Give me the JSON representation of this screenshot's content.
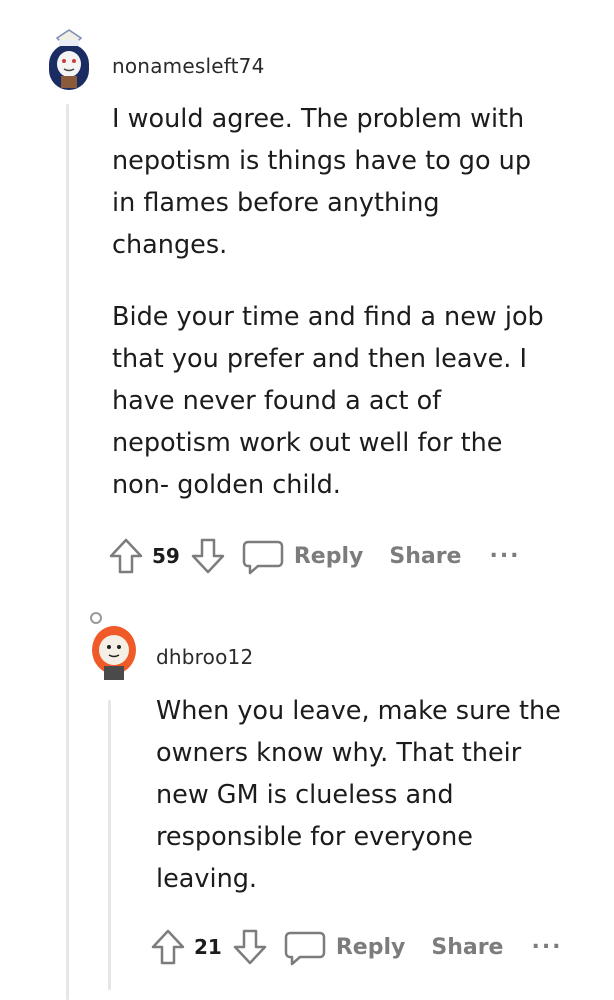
{
  "comments": [
    {
      "username": "nonamesleft74",
      "paragraphs": [
        "I would agree. The problem with nepotism is things have to go up in flames before anything changes.",
        "Bide your time and find a new job that you prefer and then leave. I have never found a act of nepotism work out well for the non- golden child."
      ],
      "votes": "59",
      "reply_label": "Reply",
      "share_label": "Share",
      "more_label": "..."
    },
    {
      "username": "dhbroo12",
      "paragraphs": [
        "When you leave, make sure the owners know why. That their new GM is clueless and responsible for everyone leaving."
      ],
      "votes": "21",
      "reply_label": "Reply",
      "share_label": "Share",
      "more_label": "..."
    }
  ],
  "colors": {
    "action_gray": "#7c7c7c",
    "thread_line": "#e6e6e6"
  }
}
